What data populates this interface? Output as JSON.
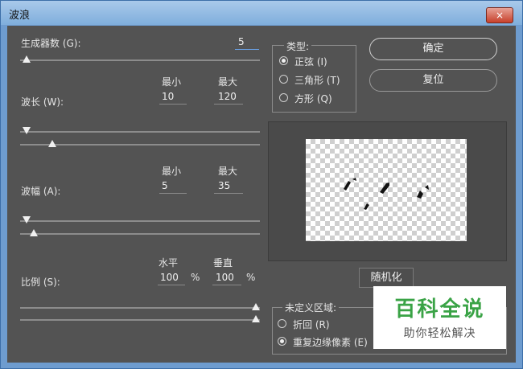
{
  "window": {
    "title": "波浪",
    "close_glyph": "×"
  },
  "generators": {
    "label": "生成器数 (G):",
    "value": "5",
    "slider_fraction": 0.01
  },
  "wavelength": {
    "label": "波长 (W):",
    "min_label": "最小",
    "max_label": "最大",
    "min_value": "10",
    "max_value": "120",
    "min_fraction": 0.01,
    "max_fraction": 0.12
  },
  "amplitude": {
    "label": "波幅 (A):",
    "min_label": "最小",
    "max_label": "最大",
    "min_value": "5",
    "max_value": "35",
    "min_fraction": 0.01,
    "max_fraction": 0.04
  },
  "scale": {
    "label": "比例 (S):",
    "h_label": "水平",
    "v_label": "垂直",
    "h_value": "100",
    "v_value": "100",
    "unit": "%",
    "h_fraction": 1.0,
    "v_fraction": 1.0
  },
  "type_group": {
    "title": "类型:",
    "options": [
      "正弦 (I)",
      "三角形 (T)",
      "方形 (Q)"
    ],
    "selected": 0
  },
  "buttons": {
    "ok": "确定",
    "reset": "复位",
    "randomize": "随机化"
  },
  "undefined_group": {
    "title": "未定义区域:",
    "options": [
      "折回 (R)",
      "重复边缘像素 (E)"
    ],
    "selected": 1
  },
  "watermark": {
    "line1": "百科全说",
    "line2": "助你轻松解决"
  }
}
